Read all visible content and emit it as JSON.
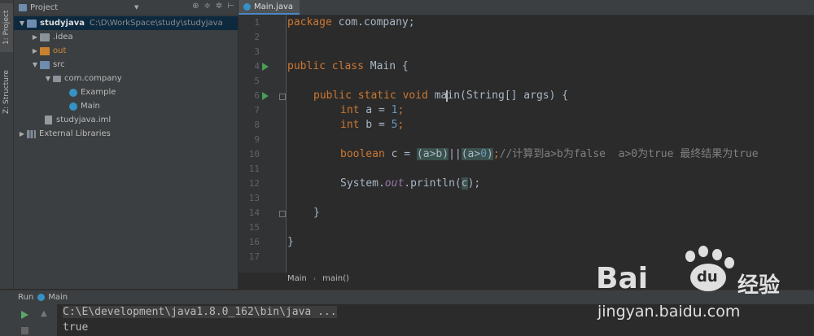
{
  "sidebar_tabs": {
    "project": "1: Project",
    "structure": "Z: Structure"
  },
  "project": {
    "header_label": "Project",
    "tree": [
      {
        "label": "studyjava",
        "path": "C:\\D\\WorkSpace\\study\\studyjava",
        "indent": 0,
        "expanded": true
      },
      {
        "label": ".idea",
        "indent": 1
      },
      {
        "label": "out",
        "indent": 1
      },
      {
        "label": "src",
        "indent": 1
      },
      {
        "label": "com.company",
        "indent": 2
      },
      {
        "label": "Example",
        "indent": 3
      },
      {
        "label": "Main",
        "indent": 3
      },
      {
        "label": "studyjava.iml",
        "indent": 1
      },
      {
        "label": "External Libraries",
        "indent": 0
      }
    ]
  },
  "editor": {
    "tab_label": "Main.java",
    "line_numbers": [
      "1",
      "2",
      "3",
      "4",
      "5",
      "6",
      "7",
      "8",
      "9",
      "10",
      "11",
      "12",
      "13",
      "14",
      "15",
      "16",
      "17"
    ],
    "code": {
      "l1_kw": "package",
      "l1_rest": " com.company;",
      "l4_kw": "public class",
      "l4_rest": " Main {",
      "l6_kw": "public static void",
      "l6_name_a": "ma",
      "l6_name_b": "in",
      "l6_rest": "(String[] args) {",
      "l7_kw": "int",
      "l7_rest": " a = ",
      "l7_num": "1",
      "l7_end": ";",
      "l8_kw": "int",
      "l8_rest": " b = ",
      "l8_num": "5",
      "l8_end": ";",
      "l10_kw": "boolean",
      "l10_a": " c = ",
      "l10_h1": "(a>b)",
      "l10_op": "||",
      "l10_h2a": "(a>",
      "l10_h2n": "0",
      "l10_h2b": ")",
      "l10_end": ";",
      "l10_comment": "//计算到a>b为false  a>0为true 最终结果为true",
      "l12_a": "System.",
      "l12_out": "out",
      "l12_b": ".println(",
      "l12_c": "c",
      "l12_d": ");",
      "l14": "}",
      "l16": "}"
    },
    "breadcrumb": [
      "Main",
      "main()"
    ]
  },
  "run": {
    "label": "Run",
    "config": "Main",
    "console_lines": [
      "C:\\E\\development\\java1.8.0_162\\bin\\java ...",
      "true"
    ]
  },
  "watermark": {
    "logo": "Bai",
    "logo_tail": "经验",
    "du": "du",
    "url": "jingyan.baidu.com"
  }
}
